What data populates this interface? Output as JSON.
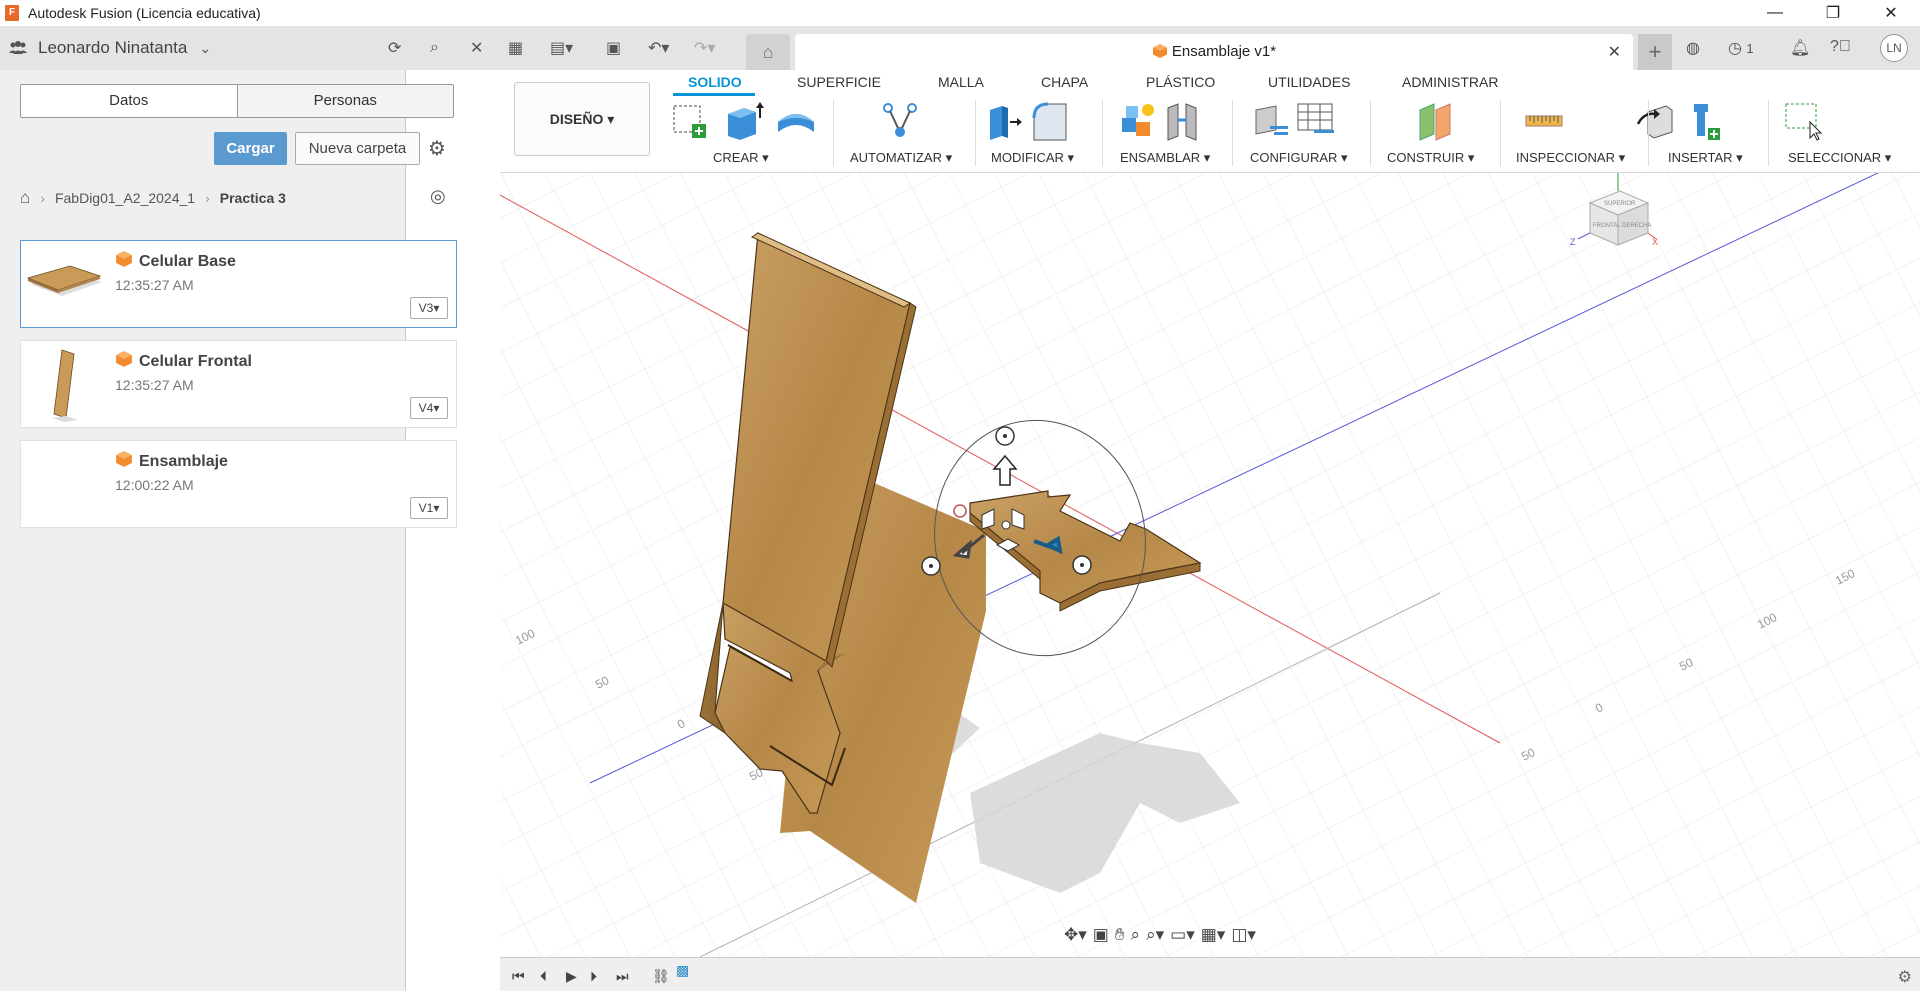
{
  "window": {
    "title": "Autodesk Fusion (Licencia educativa)",
    "logo_letter": "F",
    "minimize": "—",
    "restore": "❐",
    "close": "✕"
  },
  "appbar": {
    "user_name": "Leonardo Ninatanta",
    "document_tab_title": "Ensamblaje v1*",
    "job_count": "1",
    "avatar_initials": "LN"
  },
  "panel": {
    "tabs": [
      "Datos",
      "Personas"
    ],
    "upload_label": "Cargar",
    "new_folder_label": "Nueva carpeta",
    "breadcrumb": [
      "FabDig01_A2_2024_1",
      "Practica 3"
    ],
    "files": [
      {
        "name": "Celular Base",
        "time": "12:35:27 AM",
        "version": "V3"
      },
      {
        "name": "Celular Frontal",
        "time": "12:35:27 AM",
        "version": "V4"
      },
      {
        "name": "Ensamblaje",
        "time": "12:00:22 AM",
        "version": "V1"
      }
    ]
  },
  "toolbar": {
    "workspace": "DISEÑO ▾",
    "tabs": [
      "SOLIDO",
      "SUPERFICIE",
      "MALLA",
      "CHAPA",
      "PLÁSTICO",
      "UTILIDADES",
      "ADMINISTRAR"
    ],
    "groups": [
      "CREAR ▾",
      "AUTOMATIZAR ▾",
      "MODIFICAR ▾",
      "ENSAMBLAR ▾",
      "CONFIGURAR ▾",
      "CONSTRUIR ▾",
      "INSPECCIONAR ▾",
      "INSERTAR ▾",
      "SELECCIONAR ▾"
    ]
  },
  "viewcube": {
    "top": "SUPERIOR",
    "front": "FRONTAL",
    "right": "DERECHA",
    "axis_y": "Y",
    "axis_z": "Z",
    "axis_x": "X"
  },
  "grid_labels": [
    "100",
    "50",
    "0",
    "50",
    "150",
    "100",
    "50",
    "0",
    "50"
  ],
  "colors": {
    "accent": "#0696d7",
    "upload_button": "#5b9ad0",
    "wood": "#c49a5a",
    "axis_red": "#e05555",
    "axis_blue": "#5a5ad8"
  }
}
